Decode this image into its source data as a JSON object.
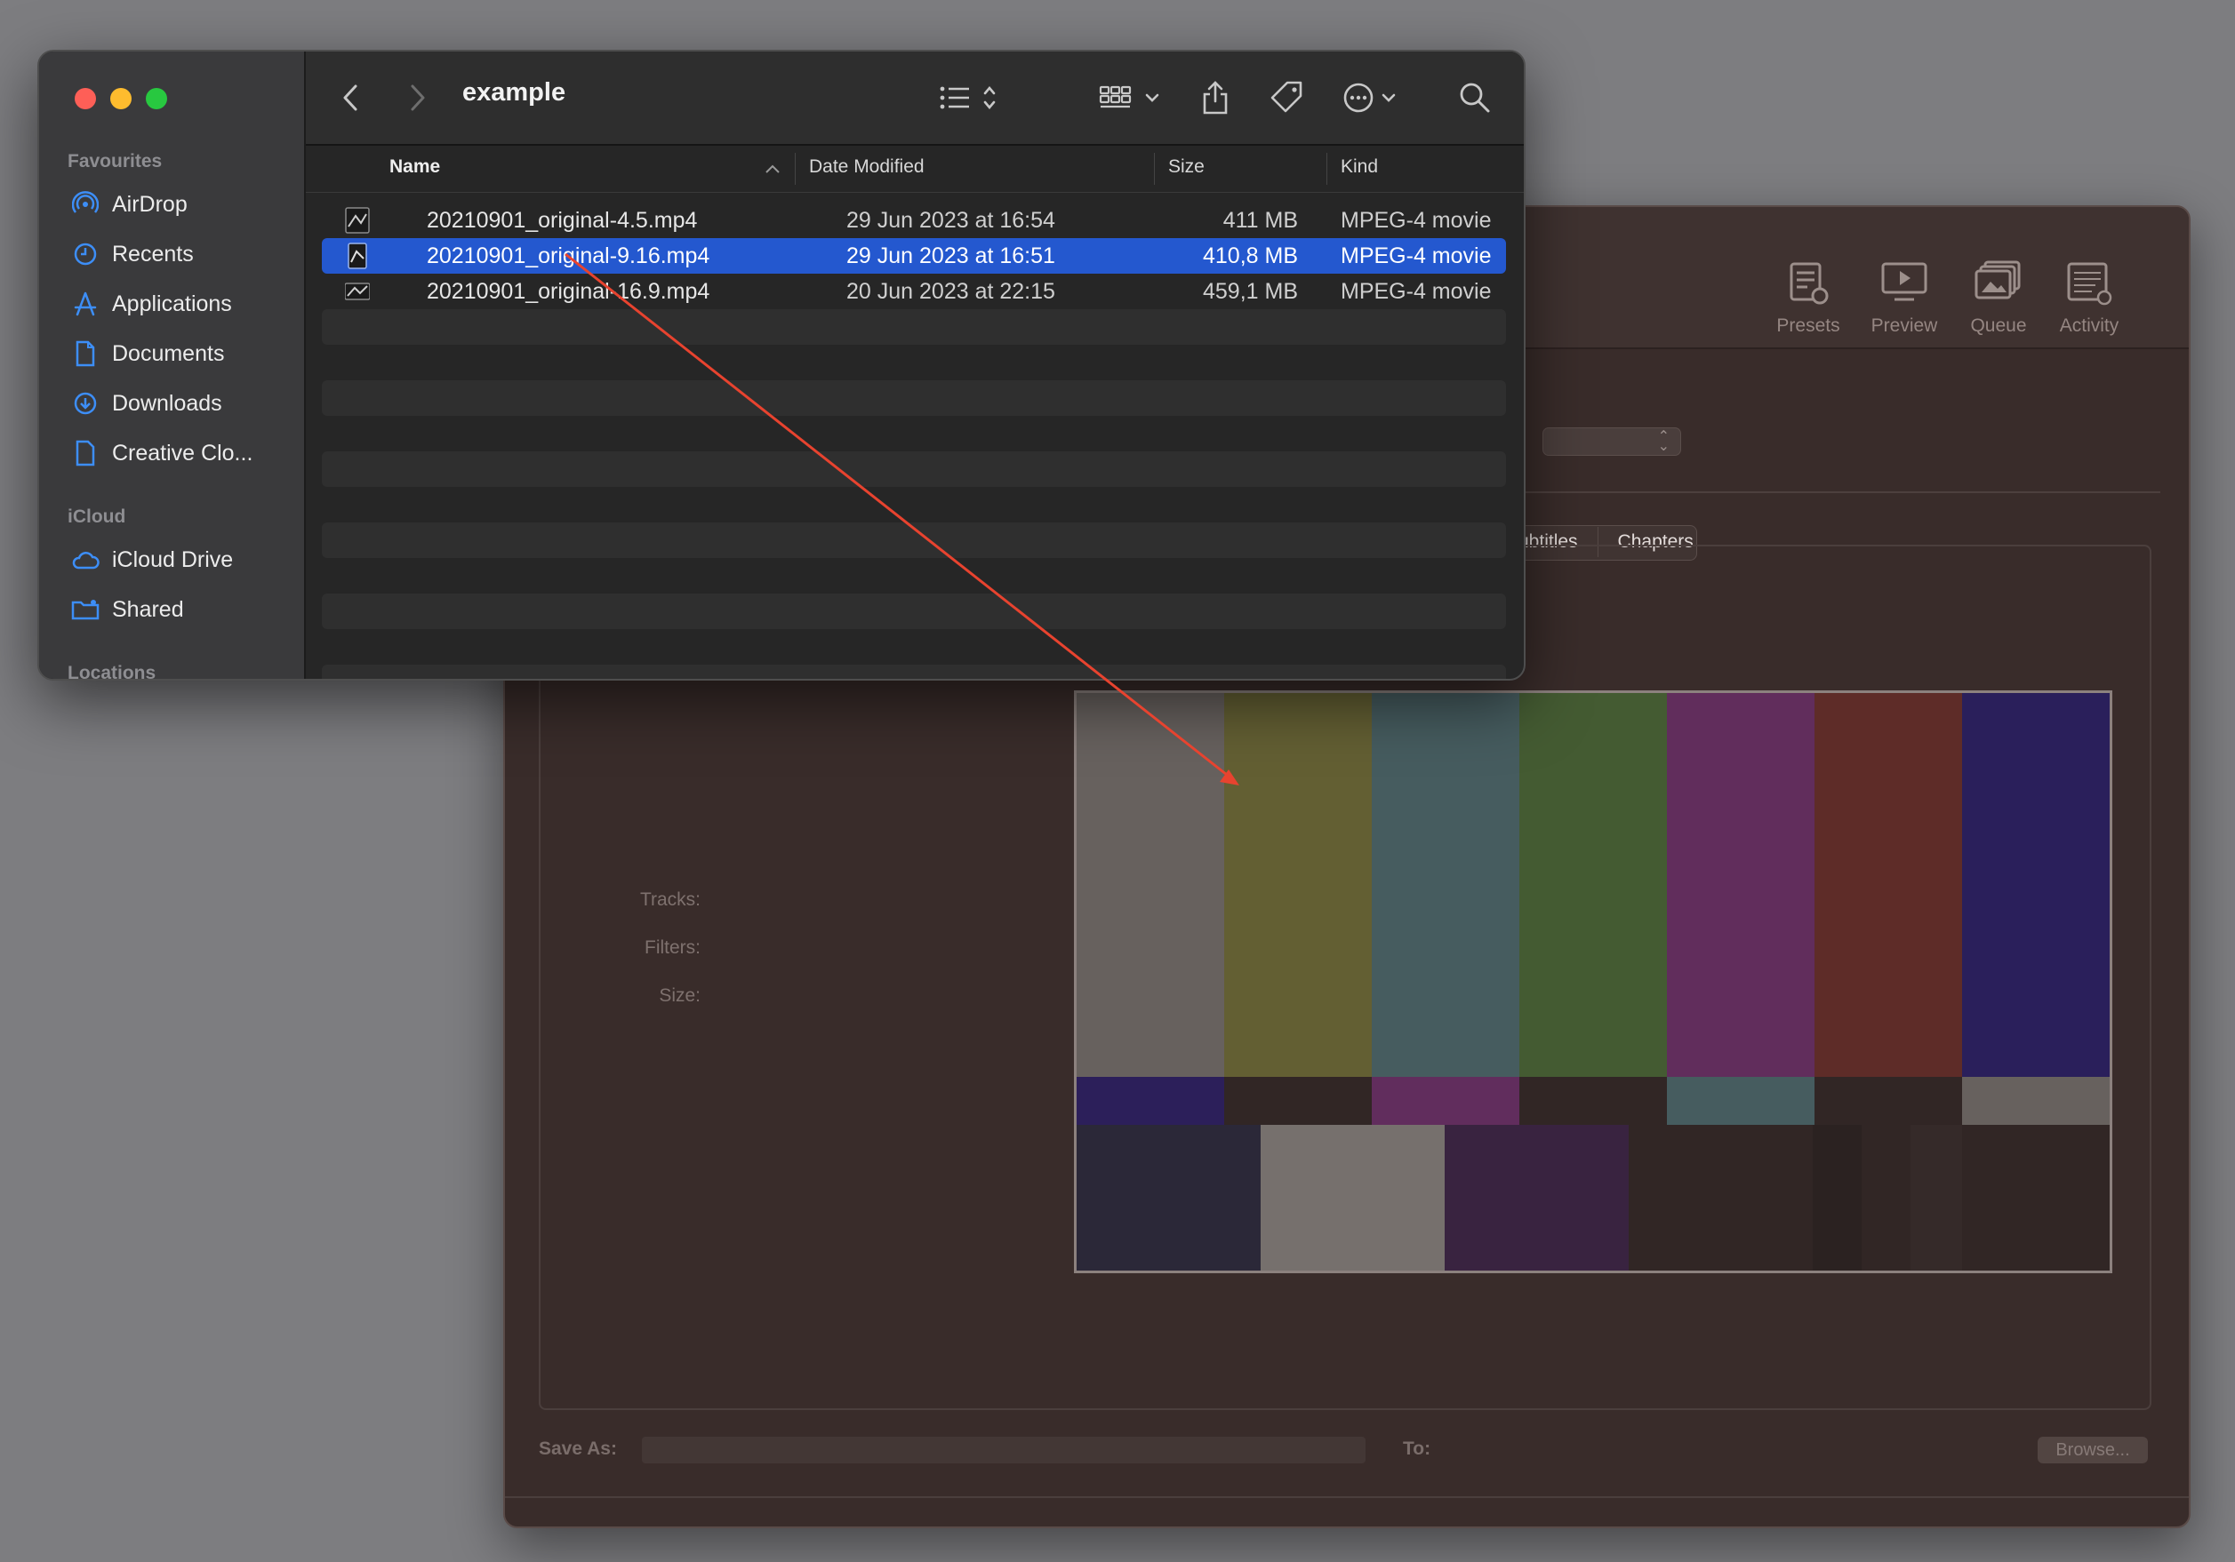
{
  "handbrake": {
    "toolbar": [
      {
        "label": "Presets",
        "icon": "presets-icon"
      },
      {
        "label": "Preview",
        "icon": "preview-icon"
      },
      {
        "label": "Queue",
        "icon": "queue-icon"
      },
      {
        "label": "Activity",
        "icon": "activity-icon"
      }
    ],
    "tabs": [
      "ubtitles",
      "Chapters"
    ],
    "fields": {
      "tracks": "Tracks:",
      "filters": "Filters:",
      "size": "Size:"
    },
    "save_as_label": "Save As:",
    "to_label": "To:",
    "browse_label": "Browse..."
  },
  "finder": {
    "title": "example",
    "sidebar": {
      "favourites_header": "Favourites",
      "favourites": [
        {
          "label": "AirDrop",
          "icon": "airdrop-icon"
        },
        {
          "label": "Recents",
          "icon": "clock-icon"
        },
        {
          "label": "Applications",
          "icon": "applications-icon"
        },
        {
          "label": "Documents",
          "icon": "document-icon"
        },
        {
          "label": "Downloads",
          "icon": "download-icon"
        },
        {
          "label": "Creative Clo...",
          "icon": "file-icon"
        }
      ],
      "icloud_header": "iCloud",
      "icloud": [
        {
          "label": "iCloud Drive",
          "icon": "cloud-icon"
        },
        {
          "label": "Shared",
          "icon": "shared-folder-icon"
        }
      ],
      "locations_header": "Locations"
    },
    "columns": {
      "name": "Name",
      "date": "Date Modified",
      "size": "Size",
      "kind": "Kind"
    },
    "files": [
      {
        "name": "20210901_original-4.5.mp4",
        "date": "29 Jun 2023 at 16:54",
        "size": "411 MB",
        "kind": "MPEG-4 movie",
        "selected": false
      },
      {
        "name": "20210901_original-9.16.mp4",
        "date": "29 Jun 2023 at 16:51",
        "size": "410,8 MB",
        "kind": "MPEG-4 movie",
        "selected": true
      },
      {
        "name": "20210901_original-16.9.mp4",
        "date": "20 Jun 2023 at 22:15",
        "size": "459,1 MB",
        "kind": "MPEG-4 movie",
        "selected": false
      }
    ]
  },
  "colors": {
    "selection": "#2458cf",
    "close": "#fe5f57",
    "minimize": "#febc2e",
    "zoom": "#28c840",
    "accent_icon": "#3d8ef7",
    "drag_arrow": "#e8432f"
  }
}
